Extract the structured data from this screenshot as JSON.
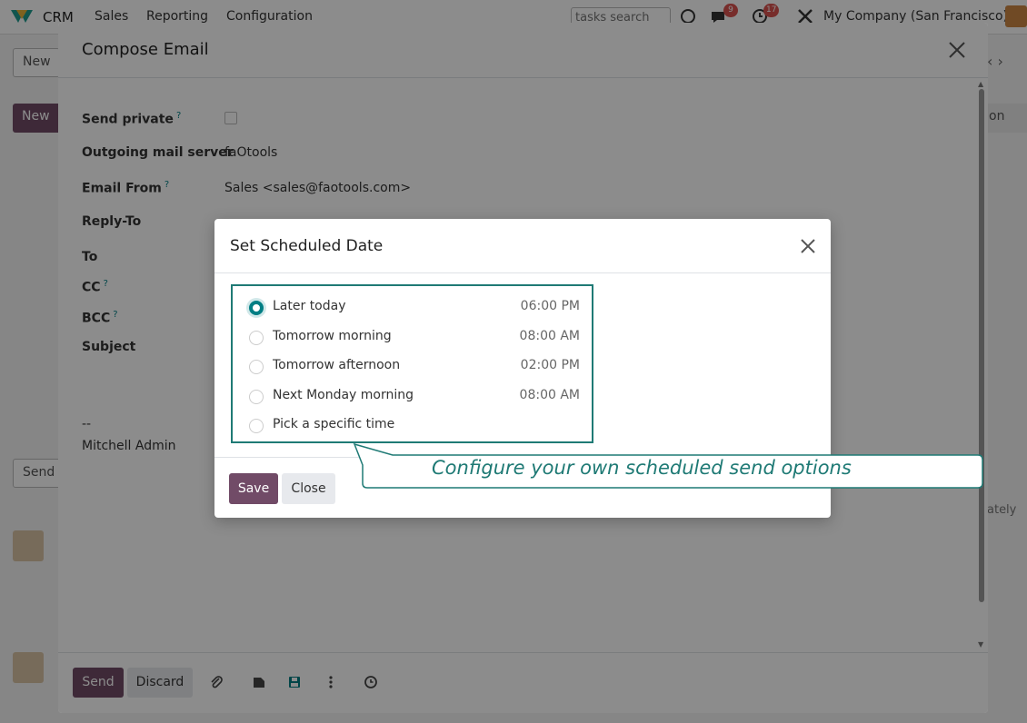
{
  "app": {
    "name": "CRM",
    "nav": [
      "Sales",
      "Reporting",
      "Configuration"
    ],
    "tasks_search_placeholder": "tasks search",
    "badge_messages": "9",
    "badge_activities": "17",
    "company": "My Company (San Francisco)"
  },
  "background": {
    "new_label": "New",
    "new_button_label": "New",
    "send_label": "Send",
    "on_label": "on",
    "ately_label": "ately"
  },
  "compose": {
    "title": "Compose Email",
    "fields": {
      "send_private": "Send private",
      "outgoing_mail_server": "Outgoing mail server",
      "outgoing_mail_server_value": "faOtools",
      "email_from": "Email From",
      "email_from_value": "Sales <sales@faotools.com>",
      "reply_to": "Reply-To",
      "to": "To",
      "cc": "CC",
      "bcc": "BCC",
      "subject": "Subject"
    },
    "help_mark": "?",
    "signature_dash": "--",
    "signature_name": "Mitchell Admin",
    "send_button": "Send",
    "discard_button": "Discard"
  },
  "schedule_dialog": {
    "title": "Set Scheduled Date",
    "options": [
      {
        "label": "Later today",
        "time": "06:00 PM",
        "selected": true
      },
      {
        "label": "Tomorrow morning",
        "time": "08:00 AM",
        "selected": false
      },
      {
        "label": "Tomorrow afternoon",
        "time": "02:00 PM",
        "selected": false
      },
      {
        "label": "Next Monday morning",
        "time": "08:00 AM",
        "selected": false
      },
      {
        "label": "Pick a specific time",
        "time": "",
        "selected": false
      }
    ],
    "save_button": "Save",
    "close_button": "Close"
  },
  "callout": {
    "text": "Configure your own scheduled send options"
  },
  "colors": {
    "primary": "#714b67",
    "accent": "#017e84",
    "callout": "#1f7a75"
  }
}
